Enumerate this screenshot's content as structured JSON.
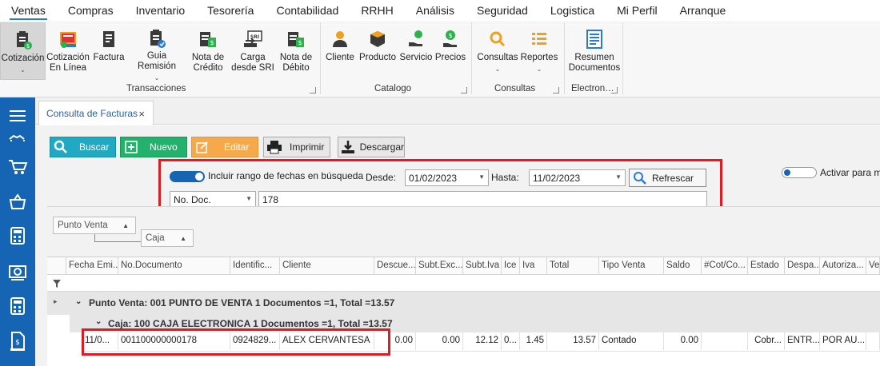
{
  "menu": [
    "Ventas",
    "Compras",
    "Inventario",
    "Tesorería",
    "Contabilidad",
    "RRHH",
    "Análisis",
    "Seguridad",
    "Logistica",
    "Mi Perfil",
    "Arranque"
  ],
  "ribbon": {
    "transacciones": {
      "label": "Transacciones",
      "items": [
        {
          "l1": "Cotización",
          "l2": "",
          "icon": "quote-icon"
        },
        {
          "l1": "Cotización",
          "l2": "En Línea",
          "icon": "online-quote-icon"
        },
        {
          "l1": "Factura",
          "l2": "",
          "icon": "invoice-icon"
        },
        {
          "l1": "Guia Remisión",
          "l2": "",
          "icon": "shipping-guide-icon"
        },
        {
          "l1": "Nota de",
          "l2": "Crédito",
          "icon": "credit-note-icon"
        },
        {
          "l1": "Carga",
          "l2": "desde SRI",
          "icon": "sri-upload-icon"
        },
        {
          "l1": "Nota de",
          "l2": "Débito",
          "icon": "debit-note-icon"
        }
      ]
    },
    "catalogo": {
      "label": "Catalogo",
      "items": [
        {
          "l1": "Cliente",
          "icon": "client-icon"
        },
        {
          "l1": "Producto",
          "icon": "product-icon"
        },
        {
          "l1": "Servicio",
          "icon": "service-icon"
        },
        {
          "l1": "Precios",
          "icon": "price-icon"
        }
      ]
    },
    "consultas": {
      "label": "Consultas",
      "items": [
        {
          "l1": "Consultas",
          "icon": "search-icon"
        },
        {
          "l1": "Reportes",
          "icon": "reports-icon"
        }
      ]
    },
    "electronicos": {
      "label": "Electron…",
      "items": [
        {
          "l1": "Resumen",
          "l2": "Documentos",
          "icon": "summary-docs-icon"
        }
      ]
    }
  },
  "tab": {
    "title": "Consulta de Facturas",
    "close": "×"
  },
  "toolbar": {
    "buscar": "Buscar",
    "nuevo": "Nuevo",
    "editar": "Editar",
    "imprimir": "Imprimir",
    "descargar": "Descargar"
  },
  "filter": {
    "range_label": "Incluir rango de fechas en búsqueda",
    "range_on": true,
    "desde_label": "Desde:",
    "desde": "01/02/2023",
    "hasta_label": "Hasta:",
    "hasta": "11/02/2023",
    "refresh": "Refrescar",
    "field": "No. Doc.",
    "value": "178",
    "activate_label": "Activar para mo"
  },
  "grouping": {
    "chip1": "Punto Venta",
    "chip2": "Caja"
  },
  "grid": {
    "columns": [
      "Fecha Emi...",
      "No.Documento",
      "Identific...",
      "Cliente",
      "Descue...",
      "Subt.Exc...",
      "Subt.Iva",
      "Ice",
      "Iva",
      "Total",
      "Tipo Venta",
      "Saldo",
      "#Cot/Co...",
      "Estado",
      "Despa...",
      "Autoriza...",
      "Ver"
    ],
    "group1": "Punto Venta: 001 PUNTO DE VENTA 1 Documentos =1, Total =13.57",
    "group2": "Caja: 100 CAJA ELECTRONICA 1 Documentos =1, Total =13.57",
    "row": [
      "11/0...",
      "001100000000178",
      "0924829...",
      "ALEX CERVANTESA",
      "0.00",
      "0.00",
      "12.12",
      "0...",
      "1.45",
      "13.57",
      "Contado",
      "0.00",
      "",
      "Cobr...",
      "ENTR...",
      "POR AU...",
      ""
    ]
  },
  "colors": {
    "accent": "#1565b4",
    "red": "#e01b24",
    "teal": "#1fa9c2",
    "green": "#22b26b",
    "orange": "#f5a94a"
  }
}
